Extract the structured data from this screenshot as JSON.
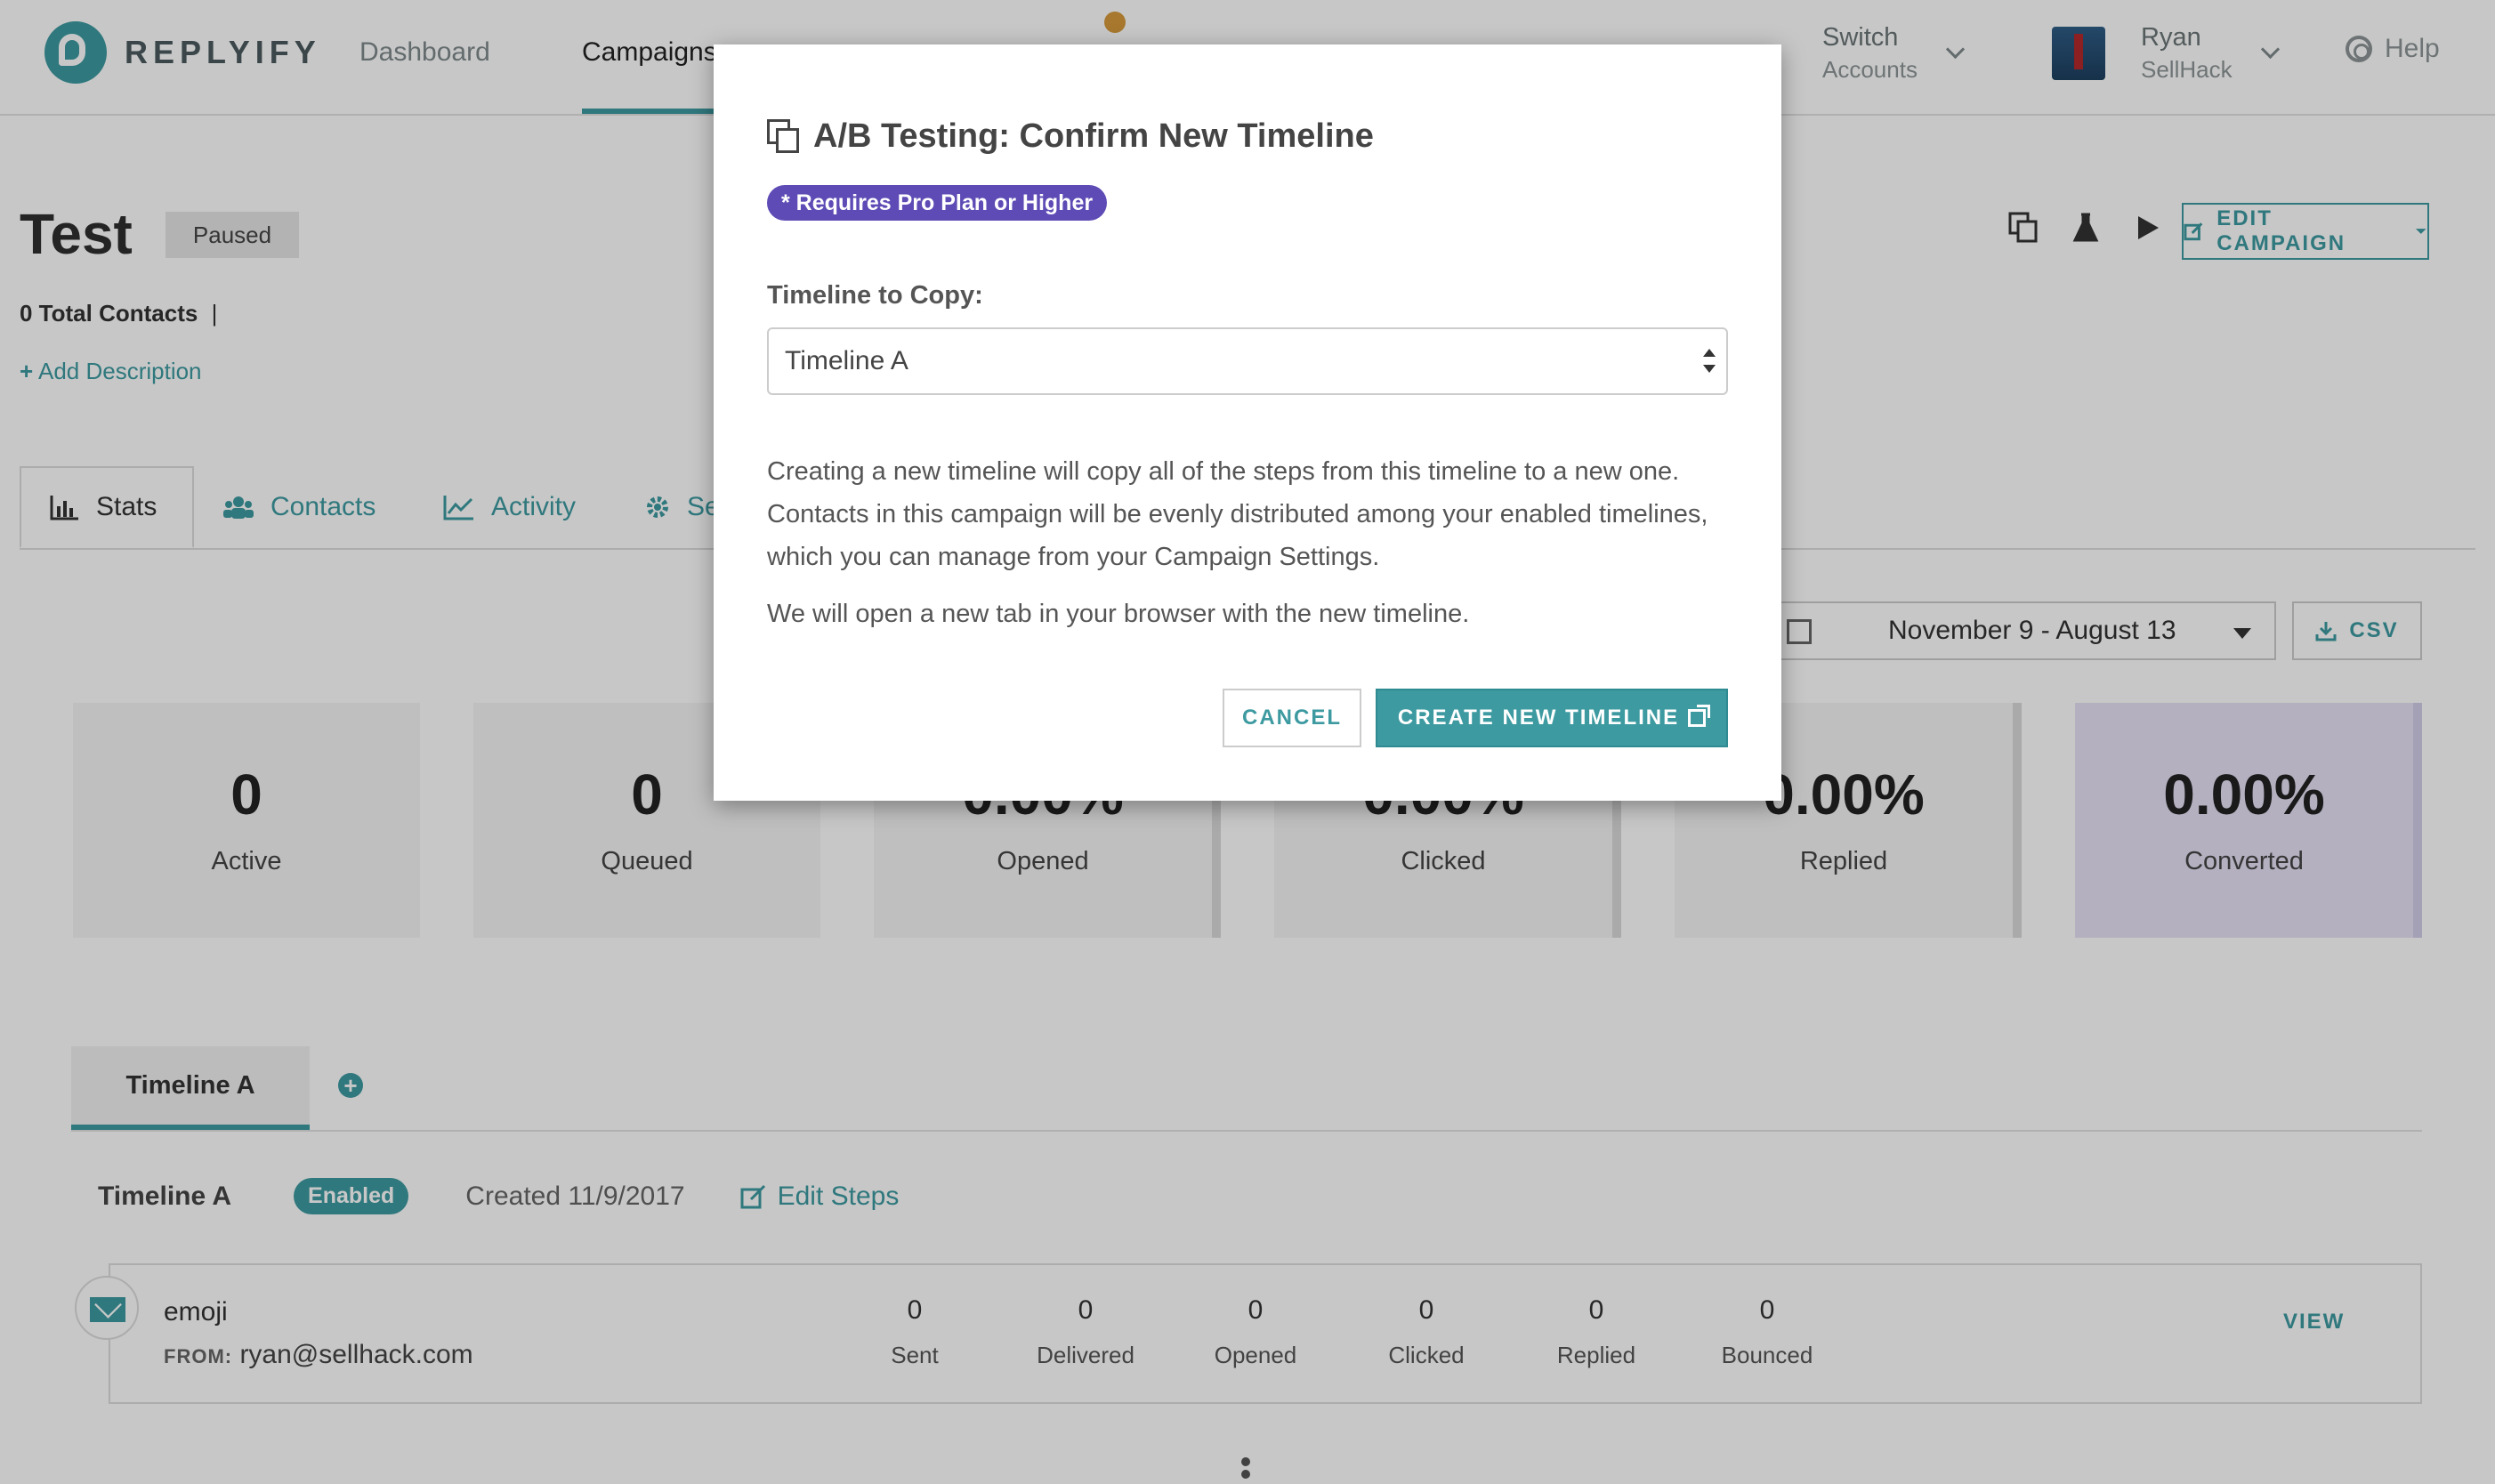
{
  "app": {
    "brand": "REPLYIFY",
    "nav": [
      "Dashboard",
      "Campaigns"
    ],
    "switch_accounts": {
      "label": "Switch",
      "sub": "Accounts"
    },
    "user": {
      "name": "Ryan",
      "org": "SellHack"
    },
    "help": "Help"
  },
  "campaign": {
    "title": "Test",
    "status": "Paused",
    "total_contacts": "0 Total Contacts",
    "separator": "|",
    "add_description": "Add Description",
    "edit_button": "EDIT CAMPAIGN"
  },
  "tabs": [
    {
      "label": "Stats",
      "icon": "bar-chart-icon"
    },
    {
      "label": "Contacts",
      "icon": "users-icon"
    },
    {
      "label": "Activity",
      "icon": "line-chart-icon"
    },
    {
      "label": "Se",
      "icon": "gear-icon"
    }
  ],
  "date_range": "November 9 - August 13",
  "csv": "CSV",
  "stats": [
    {
      "value": "0",
      "label": "Active"
    },
    {
      "value": "0",
      "label": "Queued"
    },
    {
      "value": "0.00%",
      "label": "Opened"
    },
    {
      "value": "0.00%",
      "label": "Clicked"
    },
    {
      "value": "0.00%",
      "label": "Replied"
    },
    {
      "value": "0.00%",
      "label": "Converted"
    }
  ],
  "timeline": {
    "tab_label": "Timeline A",
    "name": "Timeline A",
    "status": "Enabled",
    "created": "Created 11/9/2017",
    "edit_steps": "Edit Steps",
    "step": {
      "subject": "emoji",
      "from_label": "FROM:",
      "from": "ryan@sellhack.com",
      "metrics": [
        {
          "value": "0",
          "label": "Sent"
        },
        {
          "value": "0",
          "label": "Delivered"
        },
        {
          "value": "0",
          "label": "Opened"
        },
        {
          "value": "0",
          "label": "Clicked"
        },
        {
          "value": "0",
          "label": "Replied"
        },
        {
          "value": "0",
          "label": "Bounced"
        }
      ],
      "view": "VIEW"
    }
  },
  "modal": {
    "title": "A/B Testing: Confirm New Timeline",
    "badge": "* Requires Pro Plan or Higher",
    "field_label": "Timeline to Copy:",
    "selected": "Timeline A",
    "paragraph1": "Creating a new timeline will copy all of the steps from this timeline to a new one. Contacts in this campaign will be evenly distributed among your enabled timelines, which you can manage from your Campaign Settings.",
    "paragraph2": "We will open a new tab in your browser with the new timeline.",
    "cancel": "CANCEL",
    "create": "CREATE NEW TIMELINE"
  },
  "colors": {
    "accent": "#3d9aa1",
    "pro_badge": "#5e4bb5",
    "converted_card": "#e7e2f6",
    "status_dot": "#d69a3b"
  }
}
